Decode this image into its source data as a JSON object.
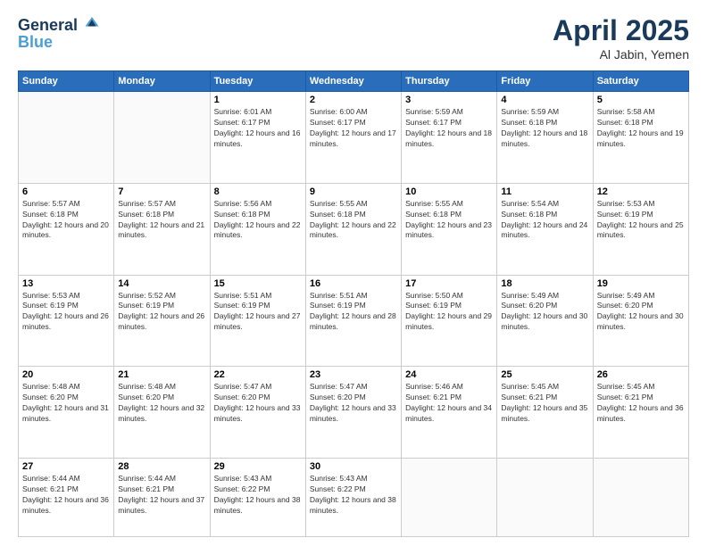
{
  "header": {
    "logo_line1": "General",
    "logo_line2": "Blue",
    "title": "April 2025",
    "location": "Al Jabin, Yemen"
  },
  "days_of_week": [
    "Sunday",
    "Monday",
    "Tuesday",
    "Wednesday",
    "Thursday",
    "Friday",
    "Saturday"
  ],
  "weeks": [
    [
      {
        "num": "",
        "info": ""
      },
      {
        "num": "",
        "info": ""
      },
      {
        "num": "1",
        "info": "Sunrise: 6:01 AM\nSunset: 6:17 PM\nDaylight: 12 hours and 16 minutes."
      },
      {
        "num": "2",
        "info": "Sunrise: 6:00 AM\nSunset: 6:17 PM\nDaylight: 12 hours and 17 minutes."
      },
      {
        "num": "3",
        "info": "Sunrise: 5:59 AM\nSunset: 6:17 PM\nDaylight: 12 hours and 18 minutes."
      },
      {
        "num": "4",
        "info": "Sunrise: 5:59 AM\nSunset: 6:18 PM\nDaylight: 12 hours and 18 minutes."
      },
      {
        "num": "5",
        "info": "Sunrise: 5:58 AM\nSunset: 6:18 PM\nDaylight: 12 hours and 19 minutes."
      }
    ],
    [
      {
        "num": "6",
        "info": "Sunrise: 5:57 AM\nSunset: 6:18 PM\nDaylight: 12 hours and 20 minutes."
      },
      {
        "num": "7",
        "info": "Sunrise: 5:57 AM\nSunset: 6:18 PM\nDaylight: 12 hours and 21 minutes."
      },
      {
        "num": "8",
        "info": "Sunrise: 5:56 AM\nSunset: 6:18 PM\nDaylight: 12 hours and 22 minutes."
      },
      {
        "num": "9",
        "info": "Sunrise: 5:55 AM\nSunset: 6:18 PM\nDaylight: 12 hours and 22 minutes."
      },
      {
        "num": "10",
        "info": "Sunrise: 5:55 AM\nSunset: 6:18 PM\nDaylight: 12 hours and 23 minutes."
      },
      {
        "num": "11",
        "info": "Sunrise: 5:54 AM\nSunset: 6:18 PM\nDaylight: 12 hours and 24 minutes."
      },
      {
        "num": "12",
        "info": "Sunrise: 5:53 AM\nSunset: 6:19 PM\nDaylight: 12 hours and 25 minutes."
      }
    ],
    [
      {
        "num": "13",
        "info": "Sunrise: 5:53 AM\nSunset: 6:19 PM\nDaylight: 12 hours and 26 minutes."
      },
      {
        "num": "14",
        "info": "Sunrise: 5:52 AM\nSunset: 6:19 PM\nDaylight: 12 hours and 26 minutes."
      },
      {
        "num": "15",
        "info": "Sunrise: 5:51 AM\nSunset: 6:19 PM\nDaylight: 12 hours and 27 minutes."
      },
      {
        "num": "16",
        "info": "Sunrise: 5:51 AM\nSunset: 6:19 PM\nDaylight: 12 hours and 28 minutes."
      },
      {
        "num": "17",
        "info": "Sunrise: 5:50 AM\nSunset: 6:19 PM\nDaylight: 12 hours and 29 minutes."
      },
      {
        "num": "18",
        "info": "Sunrise: 5:49 AM\nSunset: 6:20 PM\nDaylight: 12 hours and 30 minutes."
      },
      {
        "num": "19",
        "info": "Sunrise: 5:49 AM\nSunset: 6:20 PM\nDaylight: 12 hours and 30 minutes."
      }
    ],
    [
      {
        "num": "20",
        "info": "Sunrise: 5:48 AM\nSunset: 6:20 PM\nDaylight: 12 hours and 31 minutes."
      },
      {
        "num": "21",
        "info": "Sunrise: 5:48 AM\nSunset: 6:20 PM\nDaylight: 12 hours and 32 minutes."
      },
      {
        "num": "22",
        "info": "Sunrise: 5:47 AM\nSunset: 6:20 PM\nDaylight: 12 hours and 33 minutes."
      },
      {
        "num": "23",
        "info": "Sunrise: 5:47 AM\nSunset: 6:20 PM\nDaylight: 12 hours and 33 minutes."
      },
      {
        "num": "24",
        "info": "Sunrise: 5:46 AM\nSunset: 6:21 PM\nDaylight: 12 hours and 34 minutes."
      },
      {
        "num": "25",
        "info": "Sunrise: 5:45 AM\nSunset: 6:21 PM\nDaylight: 12 hours and 35 minutes."
      },
      {
        "num": "26",
        "info": "Sunrise: 5:45 AM\nSunset: 6:21 PM\nDaylight: 12 hours and 36 minutes."
      }
    ],
    [
      {
        "num": "27",
        "info": "Sunrise: 5:44 AM\nSunset: 6:21 PM\nDaylight: 12 hours and 36 minutes."
      },
      {
        "num": "28",
        "info": "Sunrise: 5:44 AM\nSunset: 6:21 PM\nDaylight: 12 hours and 37 minutes."
      },
      {
        "num": "29",
        "info": "Sunrise: 5:43 AM\nSunset: 6:22 PM\nDaylight: 12 hours and 38 minutes."
      },
      {
        "num": "30",
        "info": "Sunrise: 5:43 AM\nSunset: 6:22 PM\nDaylight: 12 hours and 38 minutes."
      },
      {
        "num": "",
        "info": ""
      },
      {
        "num": "",
        "info": ""
      },
      {
        "num": "",
        "info": ""
      }
    ]
  ]
}
